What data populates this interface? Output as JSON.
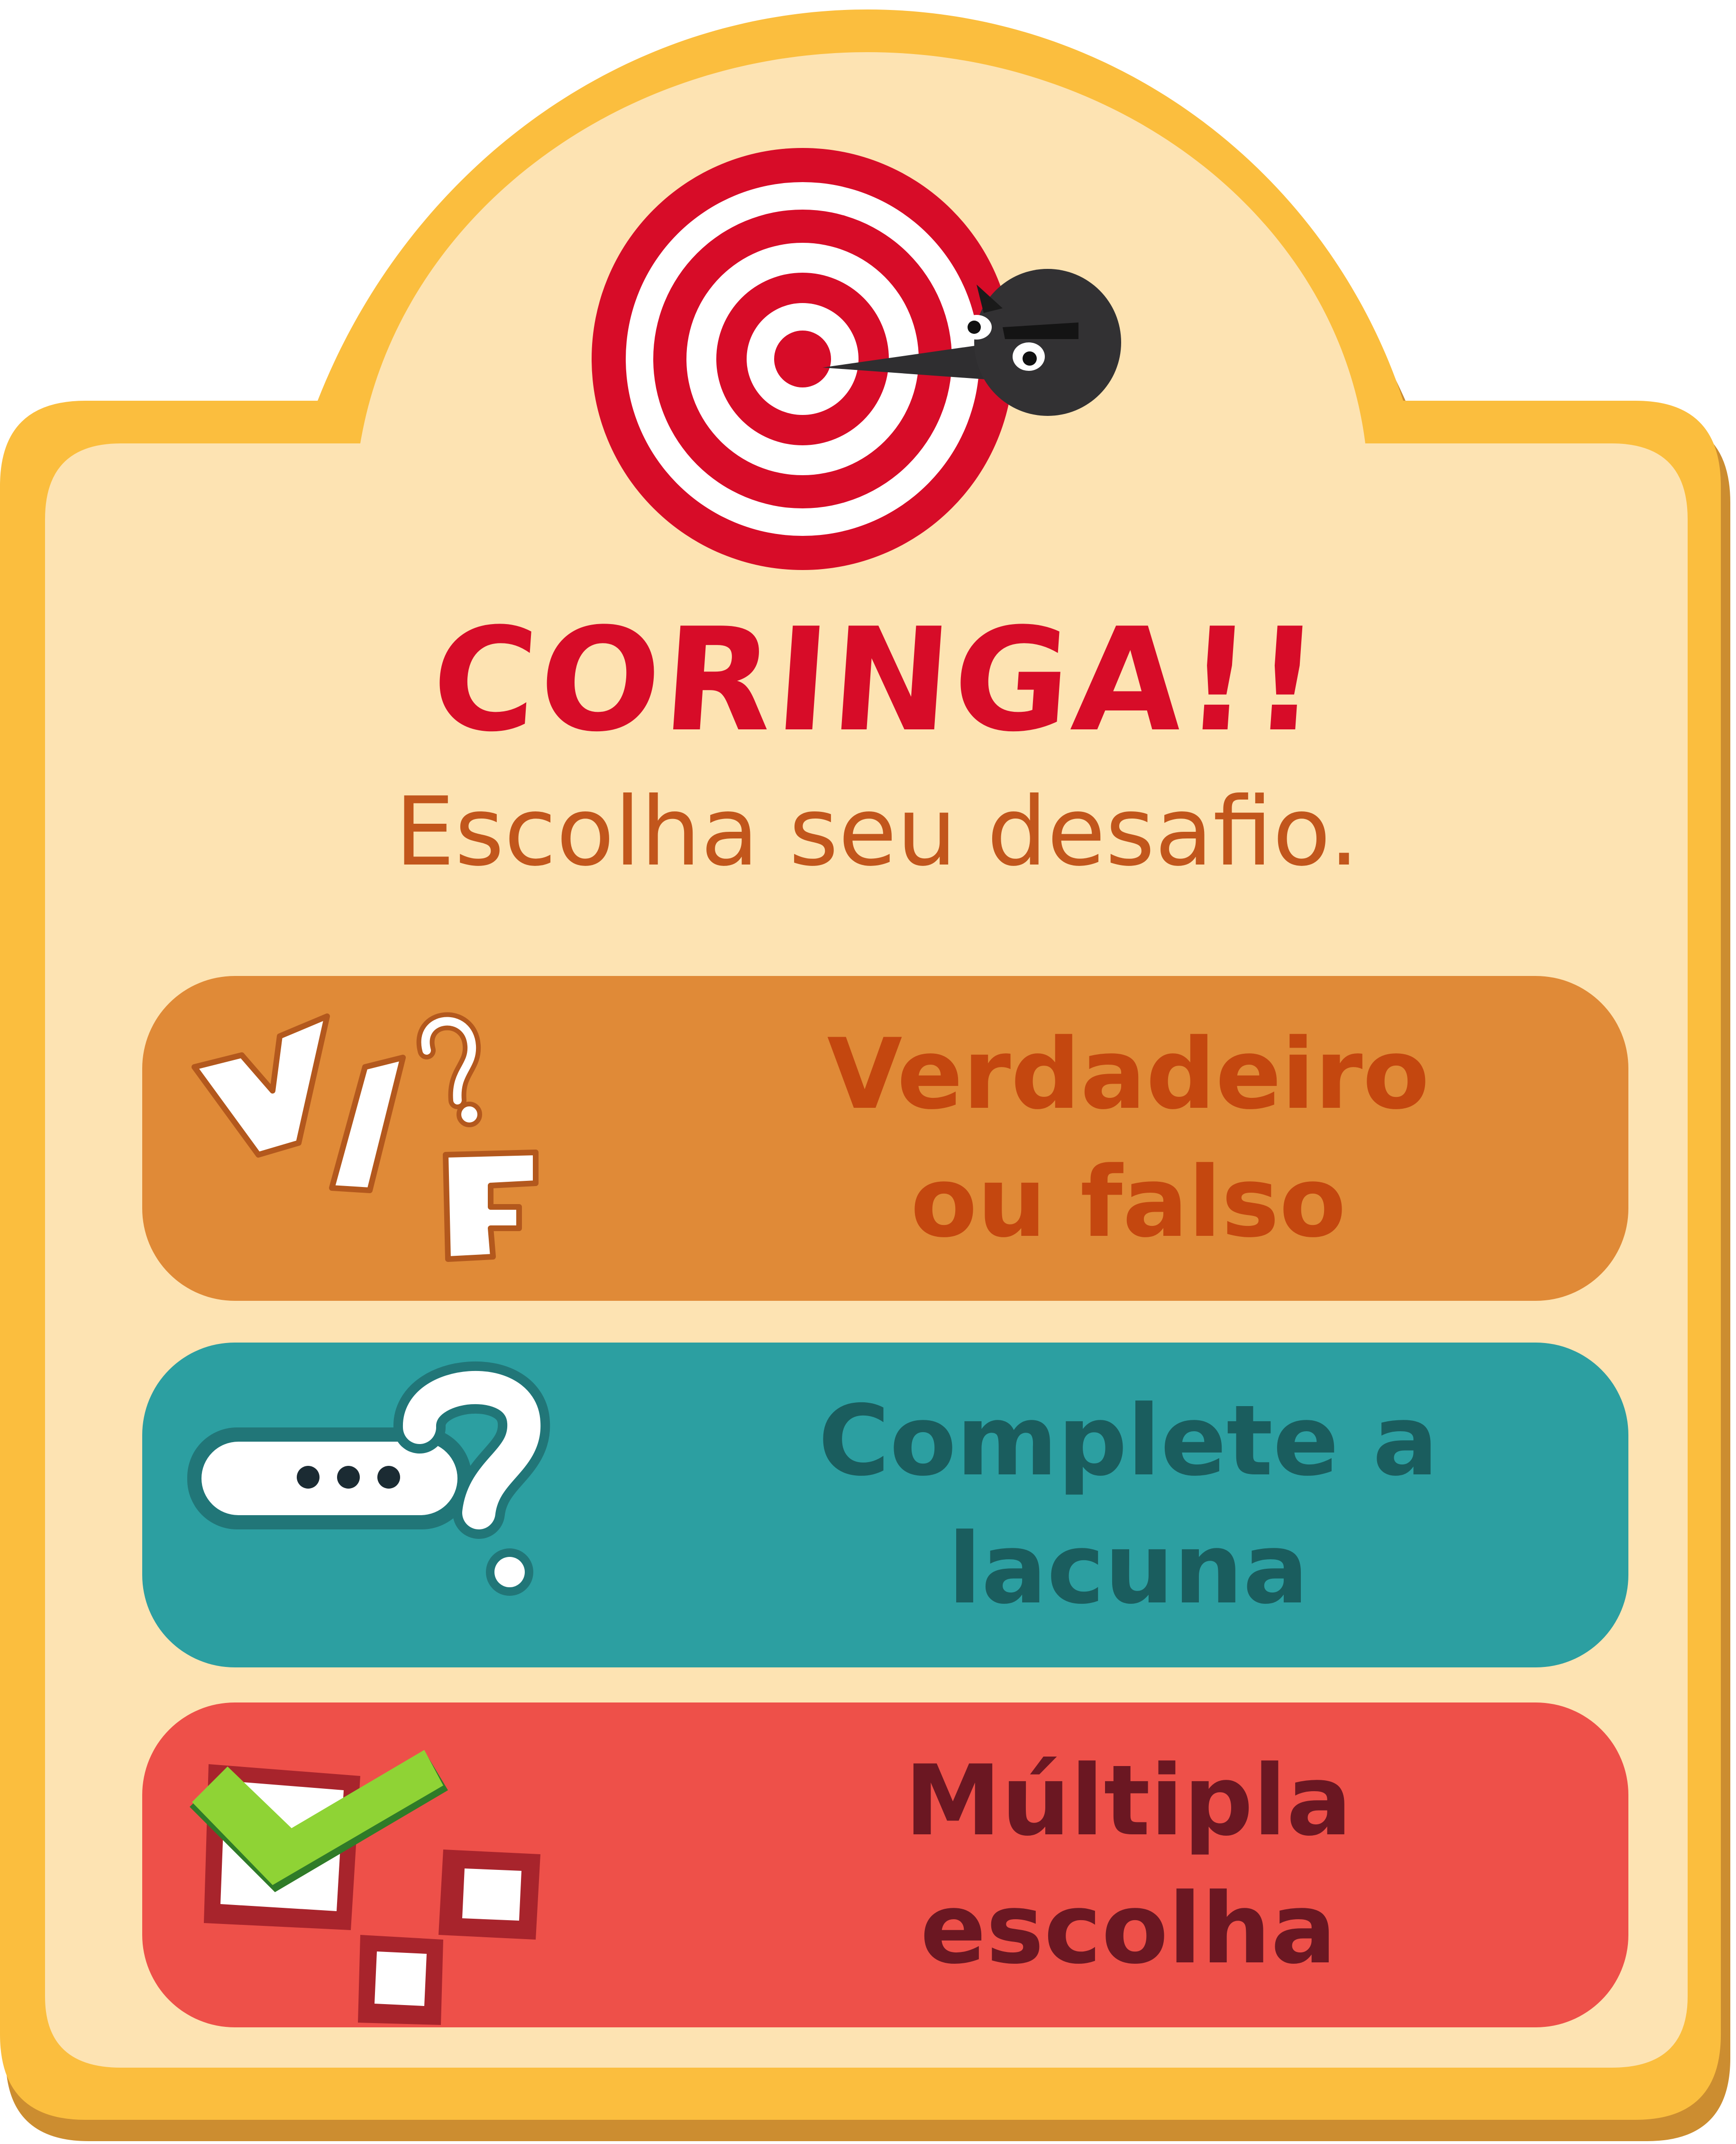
{
  "header": {
    "title": "CORINGA!!",
    "subtitle": "Escolha seu desafio."
  },
  "options": [
    {
      "line1": "Verdadeiro",
      "line2": "ou falso",
      "icon": "true-false-icon"
    },
    {
      "line1": "Complete a",
      "line2": "lacuna",
      "icon": "fill-blank-icon"
    },
    {
      "line1": "Múltipla",
      "line2": "escolha",
      "icon": "multiple-choice-icon"
    }
  ],
  "icons": {
    "true": "V",
    "false": "F",
    "question": "?"
  },
  "colors": {
    "frame": "#fbbe3e",
    "card": "#fde3b2",
    "title": "#d70c28",
    "subtitle": "#c2561c",
    "true_false": "#e08a37",
    "fill_blank": "#2c9fa1",
    "multiple_choice": "#ee5049"
  }
}
